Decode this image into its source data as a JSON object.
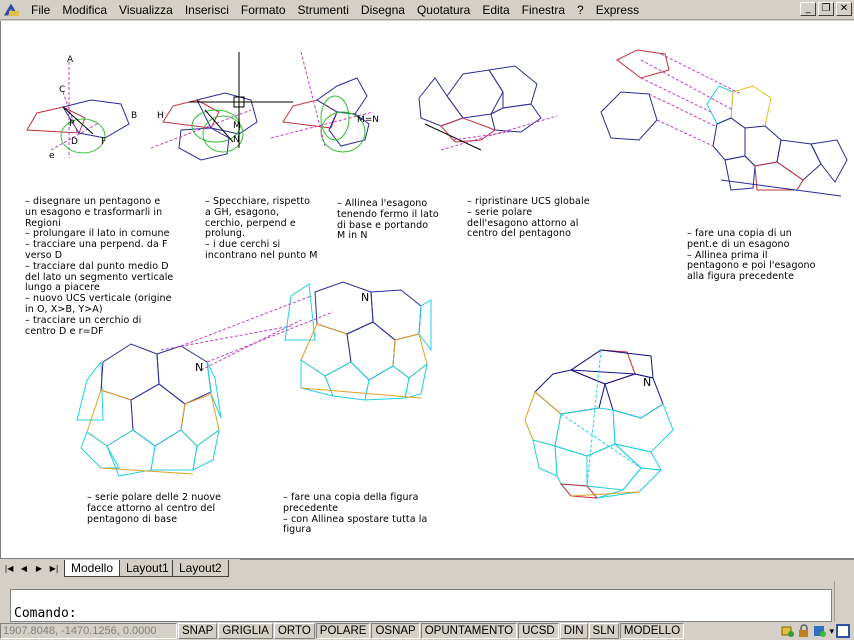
{
  "menu": {
    "items": [
      "File",
      "Modifica",
      "Visualizza",
      "Inserisci",
      "Formato",
      "Strumenti",
      "Disegna",
      "Quotatura",
      "Edita",
      "Finestra",
      "?",
      "Express"
    ],
    "controls": {
      "minimize": "_",
      "restore": "❐",
      "close": "✕"
    }
  },
  "drawing": {
    "labels": {
      "A": "A",
      "C": "C",
      "B": "B",
      "F": "F",
      "D": "D",
      "E": "e",
      "P": "P",
      "H": "H",
      "M": "M",
      "N": "N",
      "MN": "M=N",
      "N1": "N",
      "N2": "N",
      "N3": "N"
    },
    "notes": {
      "step1": "– disegnare un pentagono e\nun esagono e trasformarli in\nRegioni\n– prolungare il lato in comune\n– tracciare una perpend. da F\nverso D\n– tracciare dal punto medio D\ndel lato un segmento verticale\nlungo a piacere\n– nuovo UCS verticale (origine\nin O, X>B, Y>A)\n– tracciare un cerchio di\ncentro D e r=DF",
      "step2": "– Specchiare, rispetto\na GH, esagono,\ncerchio, perpend e\nprolung.\n– i due cerchi si\nincontrano nel punto M",
      "step3": "– Allinea l'esagono\ntenendo fermo il lato\ndi base e portando\nM in N",
      "step4": "– ripristinare UCS globale\n– serie polare\ndell'esagono attorno al\ncentro del pentagono",
      "step5": "– fare una copia di un\npent.e di un esagono\n– Allinea prima il\npentagono e poi l'esagono\nalla figura precedente",
      "step6": "– serie polare delle 2 nuove\nfacce attorno al centro del\npentagono di base",
      "step7": "– fare una copia della figura\nprecedente\n– con Allinea spostare tutta la\nfigura"
    }
  },
  "tabs": {
    "nav": [
      "|◀",
      "◀",
      "▶",
      "▶|"
    ],
    "items": [
      "Modello",
      "Layout1",
      "Layout2"
    ],
    "active": "Modello"
  },
  "command": {
    "prompt": "Comando:"
  },
  "status": {
    "coords": "1907.8048, -1470.1256, 0.0000",
    "toggles": [
      {
        "label": "SNAP",
        "on": false
      },
      {
        "label": "GRIGLIA",
        "on": false
      },
      {
        "label": "ORTO",
        "on": false
      },
      {
        "label": "POLARE",
        "on": true
      },
      {
        "label": "OSNAP",
        "on": true
      },
      {
        "label": "OPUNTAMENTO",
        "on": true
      },
      {
        "label": "UCSD",
        "on": true
      },
      {
        "label": "DIN",
        "on": false
      },
      {
        "label": "SLN",
        "on": false
      },
      {
        "label": "MODELLO",
        "on": true
      }
    ]
  },
  "colors": {
    "hexagon": "#2a2a9a",
    "pentagon": "#c0303a",
    "construction": "#c040c0",
    "circle": "#30c030",
    "cyan": "#20d0e0",
    "orange": "#e0a020",
    "blue_dark": "#10108a"
  }
}
